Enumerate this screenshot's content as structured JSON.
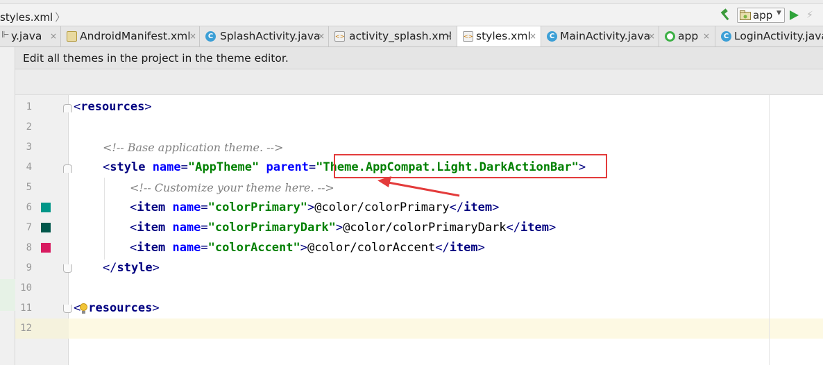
{
  "breadcrumb": {
    "file": "styles.xml",
    "separator": "〉"
  },
  "toolbar": {
    "hammer_icon": "hammer-icon",
    "run_config": "app",
    "run_icon": "run-icon",
    "apply_changes_icon": "lightning-icon"
  },
  "tabs": [
    {
      "label": "y.java",
      "icon": "java-class-icon",
      "active": false
    },
    {
      "label": "AndroidManifest.xml",
      "icon": "android-manifest-icon",
      "active": false
    },
    {
      "label": "SplashActivity.java",
      "icon": "java-class-icon",
      "active": false
    },
    {
      "label": "activity_splash.xml",
      "icon": "xml-icon",
      "active": false
    },
    {
      "label": "styles.xml",
      "icon": "xml-icon",
      "active": true
    },
    {
      "label": "MainActivity.java",
      "icon": "java-class-icon",
      "active": false
    },
    {
      "label": "app",
      "icon": "app-module-icon",
      "active": false
    },
    {
      "label": "LoginActivity.java",
      "icon": "java-class-icon",
      "active": false
    }
  ],
  "tab_close_glyph": "×",
  "banner": {
    "text": "Edit all themes in the project in the theme editor."
  },
  "editor": {
    "line_numbers": [
      "1",
      "2",
      "3",
      "4",
      "5",
      "6",
      "7",
      "8",
      "9",
      "10",
      "11",
      "12"
    ],
    "lines": {
      "l1": {
        "open": "<",
        "tag": "resources",
        "close": ">"
      },
      "l3": {
        "comment": "<!-- Base application theme. -->"
      },
      "l4": {
        "open": "<",
        "tag": "style",
        "attr1": "name",
        "eq1": "=",
        "val1": "\"AppTheme\"",
        "attr2": "parent",
        "eq2": "=",
        "q_open": "\"",
        "val2": "Theme.AppCompat.Light.DarkActionBar",
        "q_close": "\"",
        "close": ">"
      },
      "l5": {
        "comment": "<!-- Customize your theme here. -->"
      },
      "l6": {
        "open": "<",
        "tag": "item",
        "attr": "name",
        "eq": "=",
        "val": "\"colorPrimary\"",
        "close": ">",
        "text": "@color/colorPrimary",
        "end_open": "</",
        "end_tag": "item",
        "end_close": ">"
      },
      "l7": {
        "open": "<",
        "tag": "item",
        "attr": "name",
        "eq": "=",
        "val": "\"colorPrimaryDark\"",
        "close": ">",
        "text": "@color/colorPrimaryDark",
        "end_open": "</",
        "end_tag": "item",
        "end_close": ">"
      },
      "l8": {
        "open": "<",
        "tag": "item",
        "attr": "name",
        "eq": "=",
        "val": "\"colorAccent\"",
        "close": ">",
        "text": "@color/colorAccent",
        "end_open": "</",
        "end_tag": "item",
        "end_close": ">"
      },
      "l9": {
        "open": "</",
        "tag": "style",
        "close": ">"
      },
      "l11": {
        "open": "<",
        "tag": "resources",
        "close": ">"
      }
    },
    "color_swatches": {
      "colorPrimary": "#009688",
      "colorPrimaryDark": "#00574B",
      "colorAccent": "#D81B60"
    }
  },
  "annotation": {
    "color": "#E33B3B"
  }
}
